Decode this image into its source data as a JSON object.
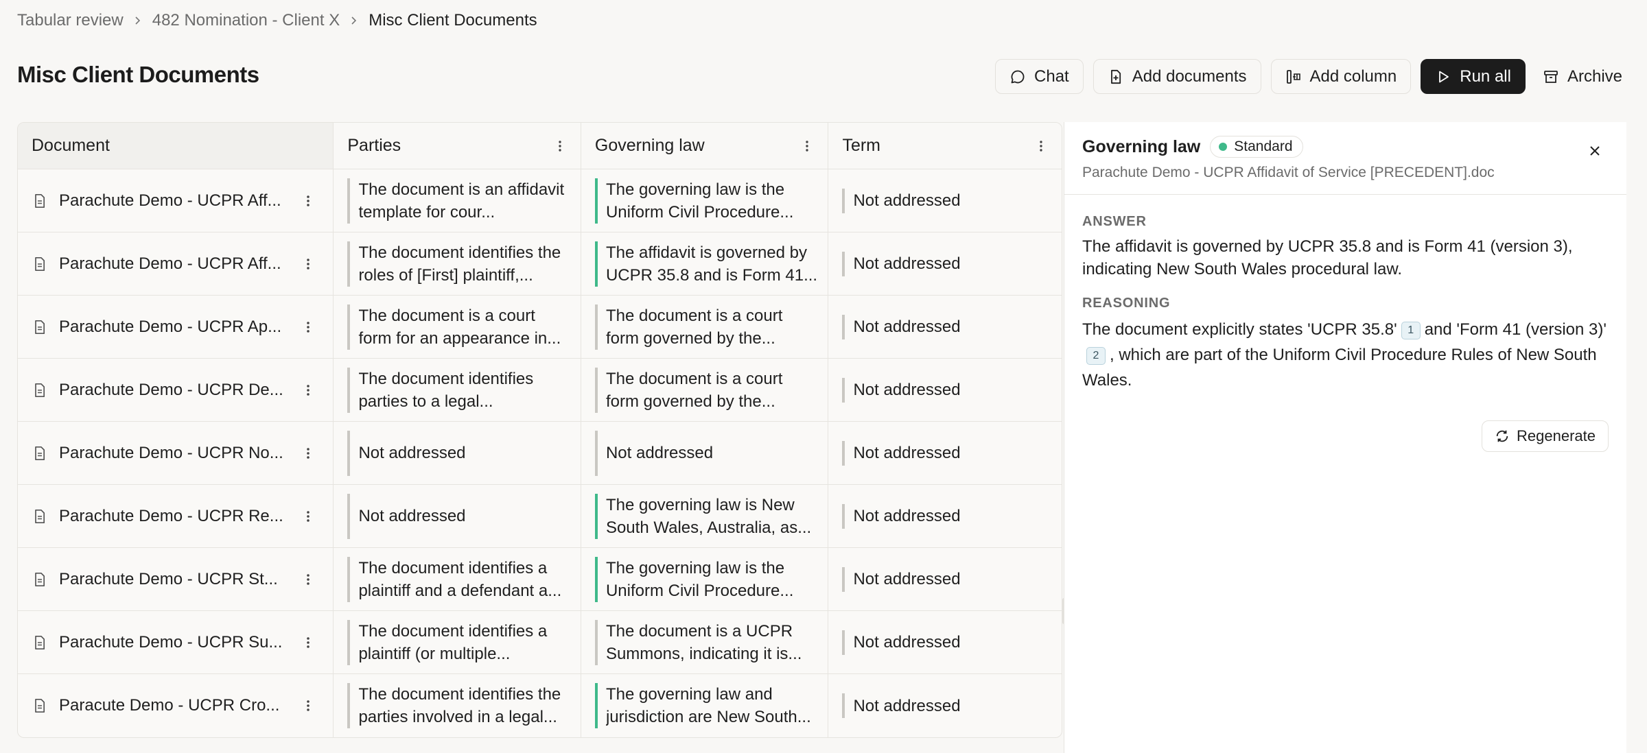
{
  "breadcrumb": {
    "items": [
      "Tabular review",
      "482 Nomination - Client X",
      "Misc Client Documents"
    ]
  },
  "header": {
    "title": "Misc Client Documents"
  },
  "toolbar": {
    "chat": "Chat",
    "add_documents": "Add documents",
    "add_column": "Add column",
    "run_all": "Run all",
    "archive": "Archive"
  },
  "table": {
    "columns": [
      "Document",
      "Parties",
      "Governing law",
      "Term"
    ],
    "rows": [
      {
        "document": "Parachute Demo - UCPR Aff...",
        "parties": "The document is an affidavit template for cour...",
        "parties_status": "neutral",
        "governing_law": "The governing law is the Uniform Civil Procedure...",
        "governing_status": "green",
        "term": "Not addressed"
      },
      {
        "document": "Parachute Demo - UCPR Aff...",
        "parties": "The document identifies the roles of [First] plaintiff,...",
        "parties_status": "neutral",
        "governing_law": "The affidavit is governed by UCPR 35.8 and is Form 41...",
        "governing_status": "green",
        "term": "Not addressed"
      },
      {
        "document": "Parachute Demo - UCPR Ap...",
        "parties": "The document is a court form for an appearance in...",
        "parties_status": "neutral",
        "governing_law": "The document is a court form governed by the...",
        "governing_status": "neutral",
        "term": "Not addressed"
      },
      {
        "document": "Parachute Demo - UCPR De...",
        "parties": "The document identifies parties to a legal...",
        "parties_status": "neutral",
        "governing_law": "The document is a court form governed by the...",
        "governing_status": "neutral",
        "term": "Not addressed"
      },
      {
        "document": "Parachute Demo - UCPR No...",
        "parties": "Not addressed",
        "parties_status": "neutral",
        "governing_law": "Not addressed",
        "governing_status": "neutral",
        "term": "Not addressed"
      },
      {
        "document": "Parachute Demo - UCPR Re...",
        "parties": "Not addressed",
        "parties_status": "neutral",
        "governing_law": "The governing law is New South Wales, Australia, as...",
        "governing_status": "green",
        "term": "Not addressed"
      },
      {
        "document": "Parachute Demo - UCPR St...",
        "parties": "The document identifies a plaintiff and a defendant a...",
        "parties_status": "neutral",
        "governing_law": "The governing law is the Uniform Civil Procedure...",
        "governing_status": "green",
        "term": "Not addressed"
      },
      {
        "document": "Parachute Demo - UCPR Su...",
        "parties": "The document identifies a plaintiff (or multiple...",
        "parties_status": "neutral",
        "governing_law": "The document is a UCPR Summons, indicating it is...",
        "governing_status": "neutral",
        "term": "Not addressed"
      },
      {
        "document": "Paracute Demo - UCPR Cro...",
        "parties": "The document identifies the parties involved in a legal...",
        "parties_status": "neutral",
        "governing_law": "The governing law and jurisdiction are New South...",
        "governing_status": "green",
        "term": "Not addressed"
      }
    ]
  },
  "panel": {
    "title": "Governing law",
    "badge": "Standard",
    "subtitle": "Parachute Demo - UCPR Affidavit of Service [PRECEDENT].doc",
    "answer_label": "ANSWER",
    "answer": "The affidavit is governed by UCPR 35.8 and is Form 41 (version 3), indicating New South Wales procedural law.",
    "reasoning_label": "REASONING",
    "reasoning_part1": "The document explicitly states 'UCPR 35.8'",
    "citation1": "1",
    "reasoning_part2": "and 'Form 41 (version 3)'",
    "citation2": "2",
    "reasoning_part3": ", which are part of the Uniform Civil Procedure Rules of New South Wales.",
    "regenerate": "Regenerate"
  },
  "colors": {
    "status_green": "#3fb98a",
    "status_neutral": "#c9c7c2",
    "primary_dark": "#1c1c1c"
  }
}
